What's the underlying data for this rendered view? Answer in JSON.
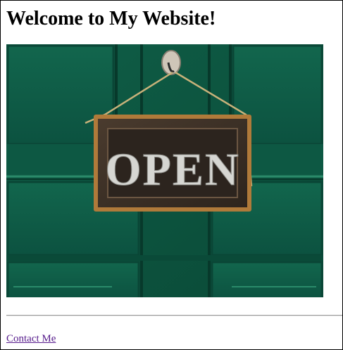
{
  "page": {
    "heading": "Welcome to My Website!",
    "image": {
      "subject": "open-sign-on-green-door",
      "sign_text": "OPEN"
    },
    "contact_link": "Contact Me"
  },
  "colors": {
    "door_green": "#0e5a44",
    "door_green_light": "#1a7a5c",
    "sign_wood": "#3a2f27",
    "sign_trim": "#b07a3a",
    "sign_letters": "#d6d6d2",
    "link": "#551a8b"
  }
}
